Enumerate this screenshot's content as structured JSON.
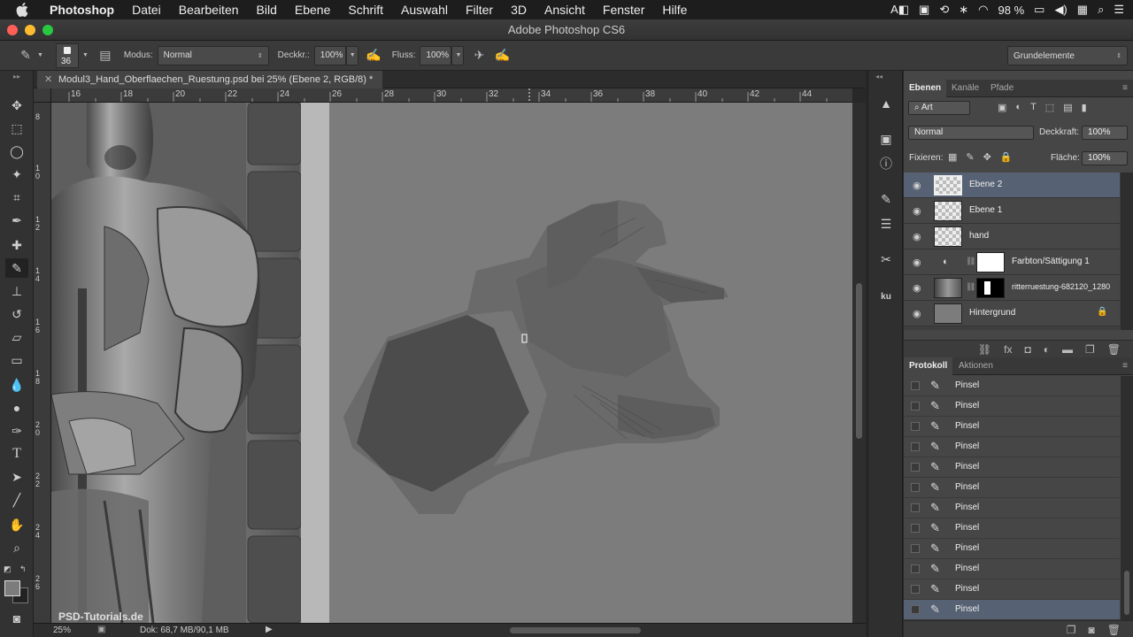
{
  "menubar": {
    "apple": "",
    "items": [
      "Photoshop",
      "Datei",
      "Bearbeiten",
      "Bild",
      "Ebene",
      "Schrift",
      "Auswahl",
      "Filter",
      "3D",
      "Ansicht",
      "Fenster",
      "Hilfe"
    ],
    "battery": "98 %"
  },
  "window": {
    "title": "Adobe Photoshop CS6"
  },
  "options": {
    "brush_size": "36",
    "mode_label": "Modus:",
    "mode_value": "Normal",
    "opacity_label": "Deckkr.:",
    "opacity_value": "100%",
    "flow_label": "Fluss:",
    "flow_value": "100%",
    "workspace": "Grundelemente"
  },
  "document": {
    "tab_title": "Modul3_Hand_Oberflaechen_Ruestung.psd bei 25% (Ebene 2, RGB/8) *",
    "ruler_h": [
      "16",
      "18",
      "20",
      "22",
      "24",
      "26",
      "28",
      "30",
      "32",
      "34",
      "36",
      "38",
      "40",
      "42",
      "44"
    ],
    "ruler_v": [
      "8",
      "1 0",
      "1 2",
      "1 4",
      "1 6",
      "1 8",
      "2 0",
      "2 2",
      "2 4",
      "2 6"
    ],
    "watermark": "PSD-Tutorials.de"
  },
  "status": {
    "zoom": "25%",
    "doc": "Dok: 68,7 MB/90,1 MB"
  },
  "layers_panel": {
    "tabs": [
      "Ebenen",
      "Kanäle",
      "Pfade"
    ],
    "filter_kind": "Art",
    "blend_mode": "Normal",
    "opacity_label": "Deckkraft:",
    "opacity_value": "100%",
    "lock_label": "Fixieren:",
    "fill_label": "Fläche:",
    "fill_value": "100%",
    "layers": [
      {
        "name": "Ebene 2",
        "selected": true
      },
      {
        "name": "Ebene 1",
        "selected": false
      },
      {
        "name": "hand",
        "selected": false
      },
      {
        "name": "Farbton/Sättigung 1",
        "selected": false
      },
      {
        "name": "ritterruestung-682120_1280",
        "selected": false
      },
      {
        "name": "Hintergrund",
        "selected": false
      }
    ]
  },
  "history_panel": {
    "tabs": [
      "Protokoll",
      "Aktionen"
    ],
    "items": [
      "Pinsel",
      "Pinsel",
      "Pinsel",
      "Pinsel",
      "Pinsel",
      "Pinsel",
      "Pinsel",
      "Pinsel",
      "Pinsel",
      "Pinsel",
      "Pinsel",
      "Pinsel"
    ]
  }
}
